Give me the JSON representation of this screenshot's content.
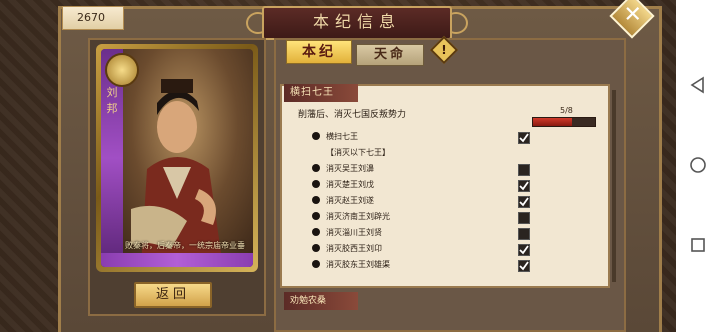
{
  "currency": {
    "value": "2670"
  },
  "header": {
    "title": "本纪信息"
  },
  "card": {
    "side_text": "刘邦",
    "quote": "败秦将，后秦帝，一统宗庙帝业垂成，天下"
  },
  "buttons": {
    "return_label": "返回",
    "close_symbol": "✕",
    "info_symbol": "!"
  },
  "tabs": [
    {
      "label": "本纪",
      "active": true
    },
    {
      "label": "天命",
      "active": false
    }
  ],
  "quest": {
    "title": "横扫七王",
    "description": "削藩后、消灭七国反叛势力",
    "progress_text": "5/8",
    "progress": 0.625,
    "tasks": [
      {
        "label": "横扫七王",
        "has_dot": true,
        "checked": true
      },
      {
        "label": "【消灭以下七王】",
        "has_dot": false,
        "checked": null
      },
      {
        "label": "消灭吴王刘濞",
        "has_dot": true,
        "checked": false
      },
      {
        "label": "消灭楚王刘戊",
        "has_dot": true,
        "checked": true
      },
      {
        "label": "消灭赵王刘遂",
        "has_dot": true,
        "checked": true
      },
      {
        "label": "消灭济南王刘辟光",
        "has_dot": true,
        "checked": false
      },
      {
        "label": "消灭淄川王刘贤",
        "has_dot": true,
        "checked": false
      },
      {
        "label": "消灭胶西王刘卬",
        "has_dot": true,
        "checked": true
      },
      {
        "label": "消灭胶东王刘雄渠",
        "has_dot": true,
        "checked": true
      }
    ]
  },
  "next_quest": {
    "title": "劝勉农桑"
  },
  "colors": {
    "progress_red": "#d23a2a",
    "tab_gold": "#e2b13a",
    "banner_red": "#5c2b26"
  }
}
